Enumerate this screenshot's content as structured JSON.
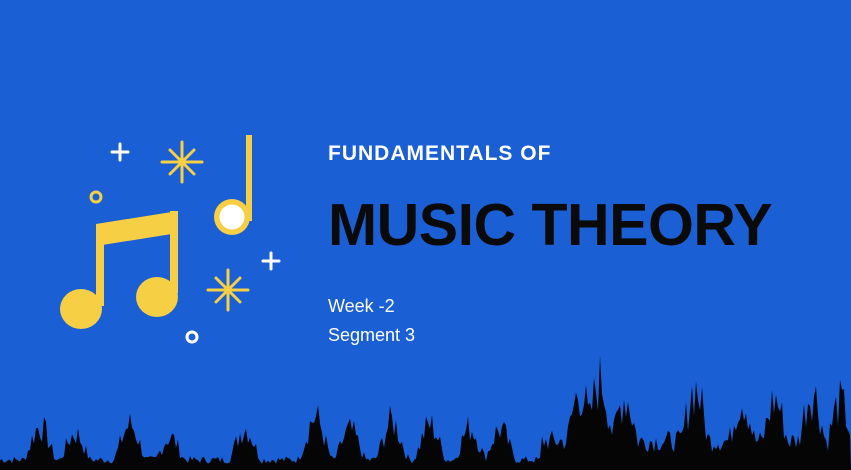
{
  "slide": {
    "subtitle": "FUNDAMENTALS OF",
    "title": "MUSIC THEORY",
    "week": "Week -2",
    "segment": "Segment 3"
  },
  "colors": {
    "background": "#1b5fd4",
    "accent_yellow": "#f6cf45",
    "title_text": "#0a0a0a",
    "text_white": "#ffffff",
    "waveform": "#050505"
  },
  "icons": [
    "beamed-notes-icon",
    "quarter-note-icon",
    "sparkle-icon",
    "plus-icon",
    "circle-icon"
  ]
}
